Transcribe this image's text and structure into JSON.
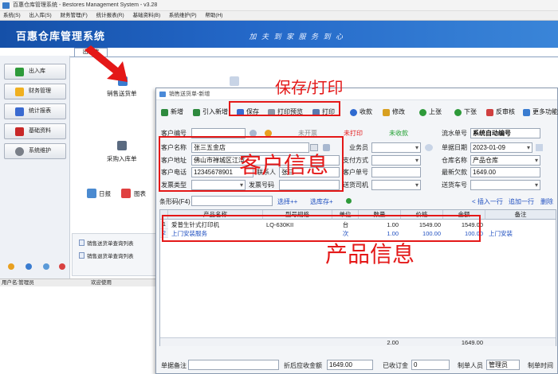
{
  "main_window": {
    "title": "百惠仓库管理系统 - Bestores Management System - v3.28",
    "menu": [
      "系统(S)",
      "出入库(S)",
      "财务管理(F)",
      "统计报表(R)",
      "基础资料(B)",
      "系统维护(P)",
      "帮助(H)"
    ],
    "banner_title": "百惠仓库管理系统",
    "banner_slogan": "加 夫 到 家   服 务 到 心",
    "tab_label": "出入库",
    "left_buttons": [
      "出入库",
      "财务管理",
      "统计报表",
      "基础资料",
      "系统维护"
    ],
    "workspace": {
      "sales_label": "销售送货单",
      "purchase_label": "采购入库单",
      "daily_label": "日报",
      "chart_label": "图表"
    },
    "list_links": [
      "销售送货单查询列表",
      "销售退货单查询列表"
    ],
    "status": {
      "user": "用户名:管理员",
      "welcome": "欢迎使用"
    },
    "colors": {
      "banner": "#1f5fbf",
      "annotation": "#e41818"
    }
  },
  "dialog": {
    "title": "销售送货单-新增",
    "toolbar": {
      "new": "新增",
      "import": "引入新增",
      "save": "保存",
      "print_preview": "打印预览",
      "print": "打印",
      "receive": "收款",
      "modify": "修改",
      "prev": "上张",
      "next": "下张",
      "unapprove": "反审核",
      "more": "更多功能"
    },
    "header": {
      "customer_code_label": "客户编号",
      "invoice_status": "未开票",
      "print_status": "未打印",
      "receive_status": "未收款",
      "serial_label": "流水单号",
      "serial_value": "系统自动编号",
      "customer_name_label": "客户名称",
      "customer_name_value": "张三五金店",
      "salesman_label": "业务员",
      "date_label": "单据日期",
      "date_value": "2023-01-09",
      "address_label": "客户地址",
      "address_value": "佛山市禅城区江湾",
      "pay_label": "支付方式",
      "warehouse_label": "仓库名称",
      "warehouse_value": "产品仓库",
      "phone_label": "客户电话",
      "phone_value": "12345678901",
      "contact_label": "联系人",
      "contact_value": "张三",
      "customer_no_label": "客户单号",
      "debt_label": "最新欠款",
      "debt_value": "1649.00",
      "invoice_type_label": "发票类型",
      "invoice_no_label": "发票号码",
      "driver_label": "送货司机",
      "vehicle_label": "送货车号"
    },
    "barcode": {
      "label": "条形码(F4)",
      "select_add": "选择++",
      "select_stock": "选库存+",
      "insert_row": "< 插入一行",
      "append_row": "追加一行",
      "delete_row": "删除"
    },
    "table": {
      "columns": [
        "产品名称",
        "型号规格",
        "单位",
        "数量",
        "价格",
        "金额",
        "备注"
      ],
      "rows": [
        {
          "no": "1",
          "name": "爱普生针式打印机",
          "model": "LQ-630KII",
          "unit": "台",
          "qty": "1.00",
          "price": "1549.00",
          "amount": "1549.00",
          "remark": ""
        },
        {
          "no": "2",
          "name": "上门安装服务",
          "model": "",
          "unit": "次",
          "qty": "1.00",
          "price": "100.00",
          "amount": "100.00",
          "remark": "上门安装"
        }
      ],
      "total_qty": "2.00",
      "total_amount": "1649.00"
    },
    "footer": {
      "remark_label": "单据备注",
      "after_label": "折后应收金额",
      "after_value": "1649.00",
      "deposit_label": "已收订金",
      "deposit_value": "0",
      "maker_label": "制单人员",
      "maker_value": "管理员",
      "time_label": "制单时间"
    }
  },
  "annotations": {
    "save_print": "保存/打印",
    "customer_info": "客户信息",
    "product_info": "产品信息"
  }
}
